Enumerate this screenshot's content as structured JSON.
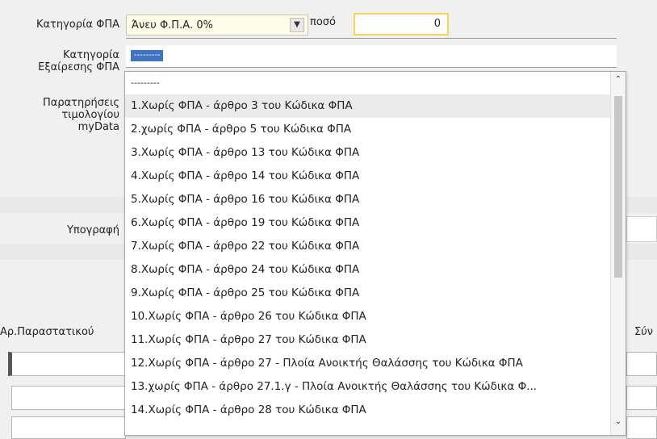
{
  "form": {
    "vat_category_label": "Κατηγορία ΦΠΑ",
    "vat_category_value": "Άνευ Φ.Π.Α. 0%",
    "amount_label": "ποσό",
    "amount_value": "0",
    "vat_exemption_label_line1": "Κατηγορία",
    "vat_exemption_label_line2": "Εξαίρεσης ΦΠΑ",
    "vat_exemption_selected": "---------",
    "notes_label_line1": "Παρατηρήσεις",
    "notes_label_line2": "τιμολογίου",
    "notes_label_line3": "myData",
    "signature_label": "Υπογραφή",
    "doc_number_label": "Αρ.Παραστατικού",
    "right_cut_label": "Σύν"
  },
  "dropdown": {
    "items": [
      "---------",
      "1.Χωρίς ΦΠΑ - άρθρο 3 του Κώδικα ΦΠΑ",
      "2.χωρίς ΦΠΑ - άρθρο 5 του Κώδικα ΦΠΑ",
      "3.Χωρίς ΦΠΑ - άρθρο 13 του Κώδικα ΦΠΑ",
      "4.Χωρίς ΦΠΑ - άρθρο 14 του Κώδικα ΦΠΑ",
      "5.Χωρίς ΦΠΑ - άρθρο 16 του Κώδικα ΦΠΑ",
      "6.Χωρίς ΦΠΑ - άρθρο 19 του Κώδικα ΦΠΑ",
      "7.Χωρίς ΦΠΑ - άρθρο 22 του Κώδικα ΦΠΑ",
      "8.Χωρίς ΦΠΑ - άρθρο 24 του Κώδικα ΦΠΑ",
      "9.Χωρίς ΦΠΑ - άρθρο 25 του Κώδικα ΦΠΑ",
      "10.Χωρίς ΦΠΑ - άρθρο 26 του Κώδικα ΦΠΑ",
      "11.Χωρίς ΦΠΑ - άρθρο 27 του Κώδικα ΦΠΑ",
      "12.Χωρίς ΦΠΑ - άρθρο 27 - Πλοία Ανοικτής Θαλάσσης του Κώδικα ΦΠΑ",
      "13.χωρίς ΦΠΑ - άρθρο 27.1.γ - Πλοία Ανοικτής Θαλάσσης του Κώδικα Φ...",
      "14.Χωρίς ΦΠΑ - άρθρο 28 του Κώδικα ΦΠΑ"
    ],
    "highlighted_index": 1,
    "scroll_up_icon": "chevron-up-icon",
    "scroll_down_icon": "chevron-down-icon"
  },
  "colors": {
    "selection_blue": "#3f74c5",
    "field_yellow": "#fffde7",
    "amount_border": "#f6d35a"
  }
}
